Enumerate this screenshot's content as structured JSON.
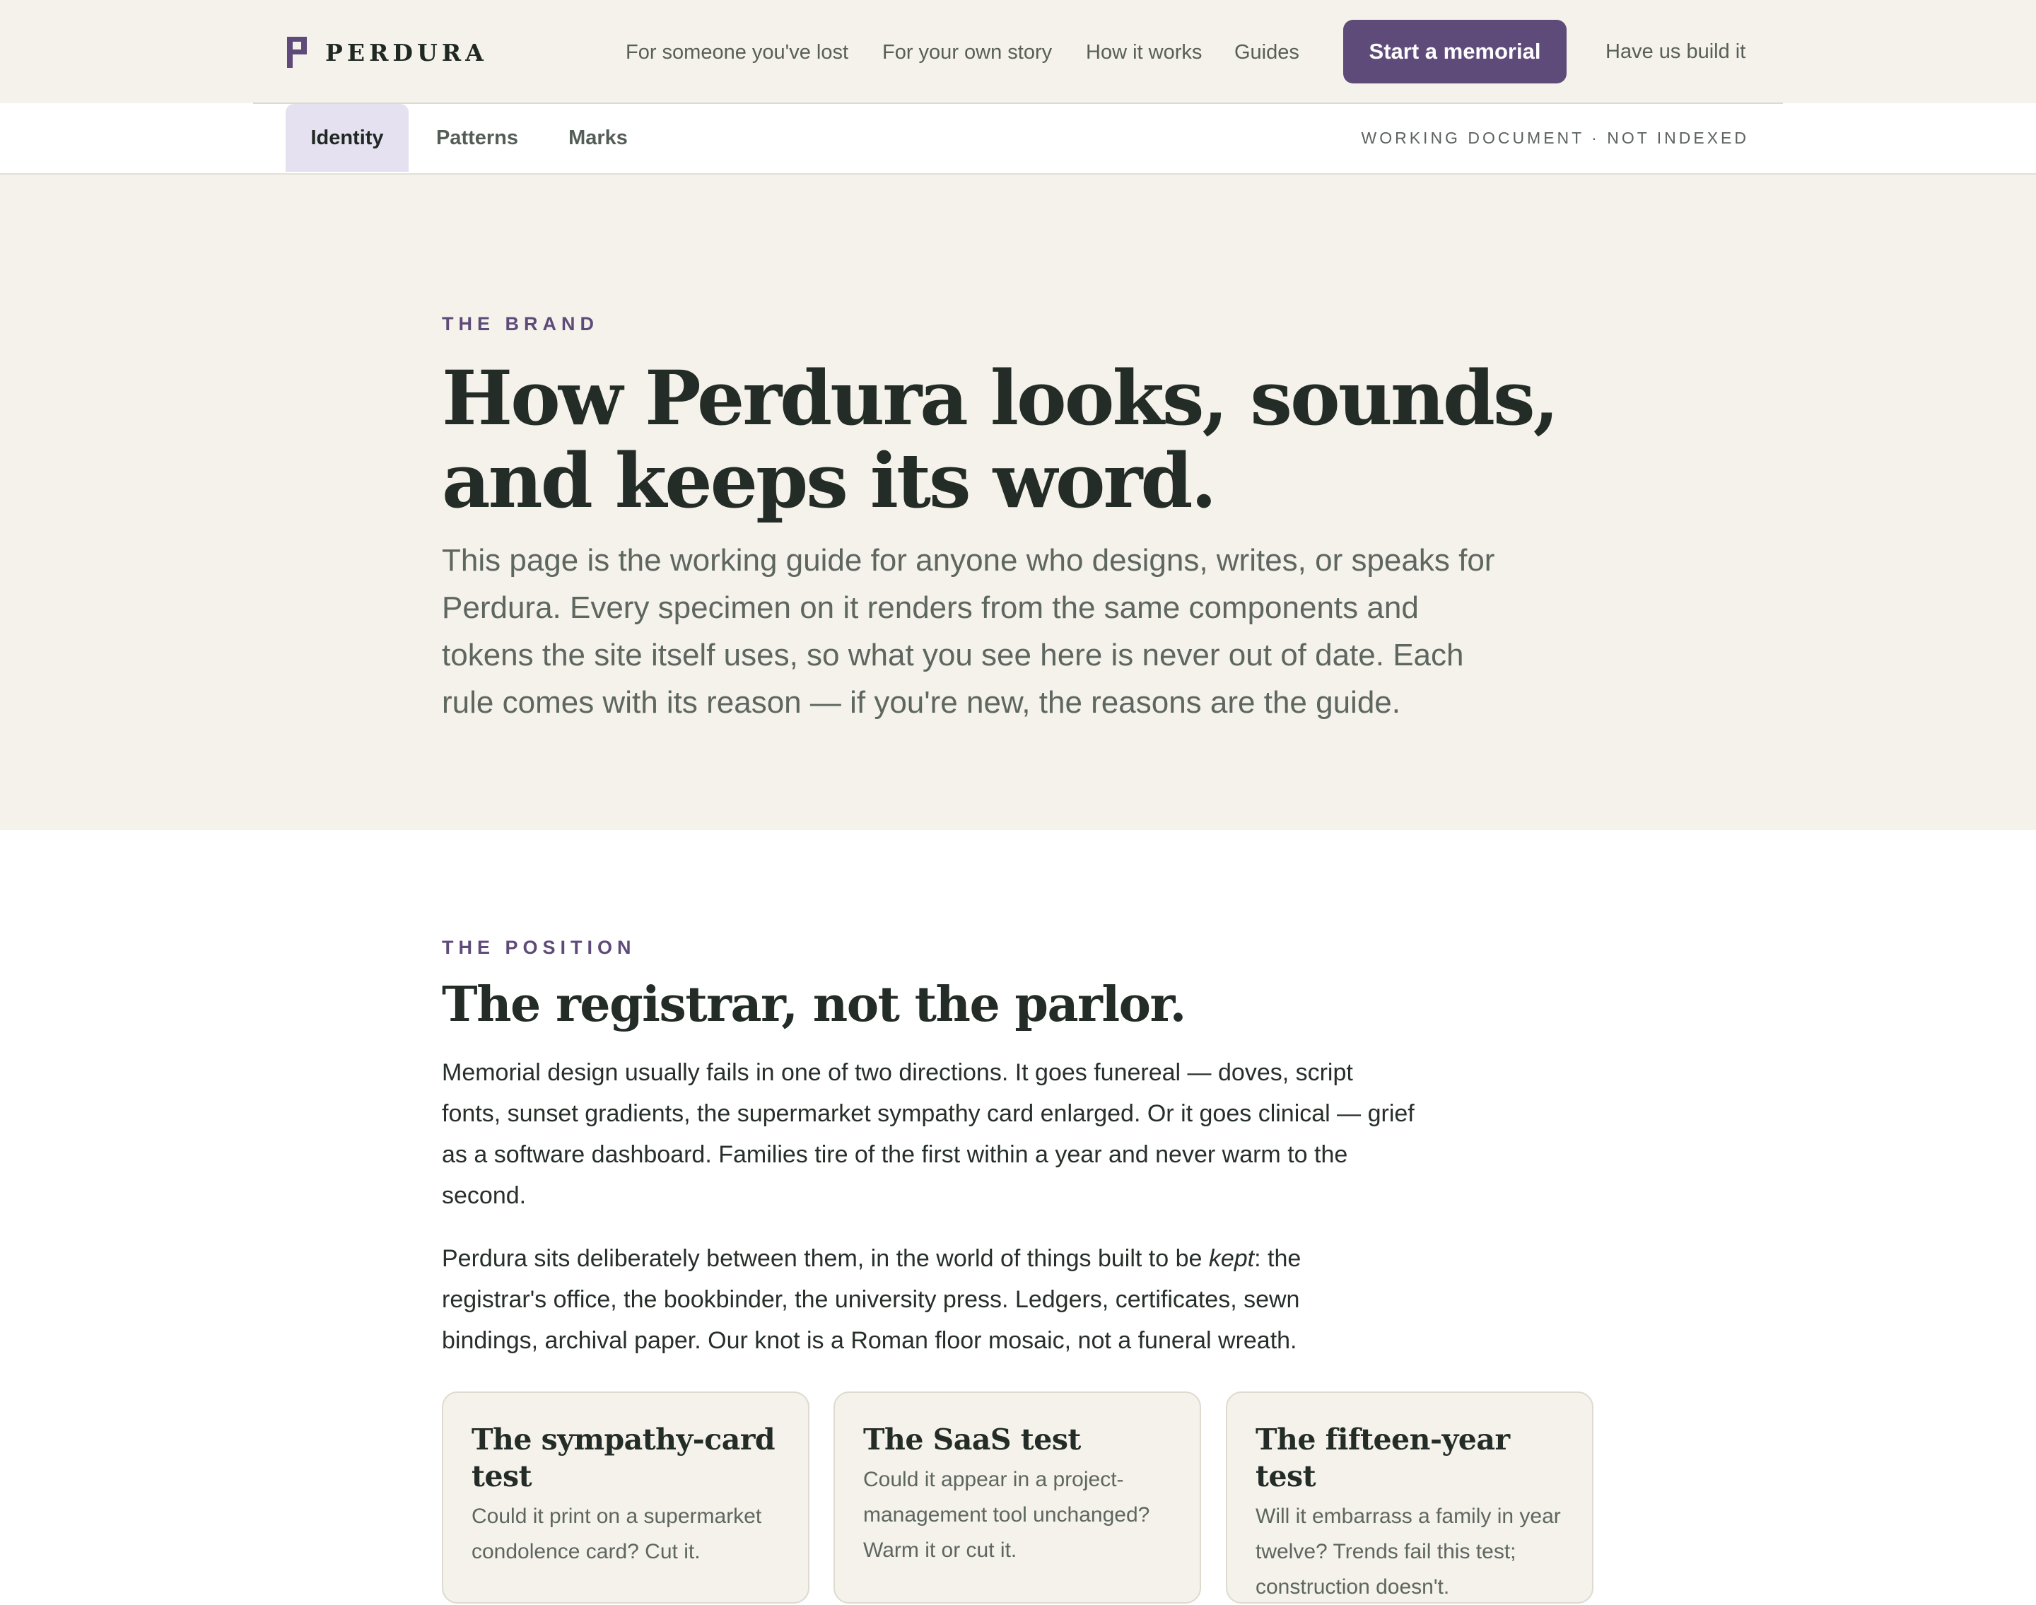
{
  "header": {
    "brand": "PERDURA",
    "nav": [
      "For someone you've lost",
      "For your own story",
      "How it works",
      "Guides"
    ],
    "cta_label": "Start a memorial",
    "secondary_link": "Have us build it",
    "accent_color": "#5e4b7a",
    "background_color": "#f4f2ea"
  },
  "subnav": {
    "tabs": [
      "Identity",
      "Patterns",
      "Marks"
    ],
    "active_tab": "Identity",
    "status": "WORKING DOCUMENT · NOT INDEXED"
  },
  "hero": {
    "eyebrow": "THE BRAND",
    "title": "How Perdura looks, sounds, and keeps its word.",
    "lede": "This page is the working guide for anyone who designs, writes, or speaks for Perdura. Every specimen on it renders from the same components and tokens the site itself uses, so what you see here is never out of date. Each rule comes with its reason — if you're new, the reasons are the guide."
  },
  "position": {
    "eyebrow": "THE POSITION",
    "title": "The registrar, not the parlor.",
    "para1": "Memorial design usually fails in one of two directions. It goes funereal — doves, script fonts, sunset gradients, the supermarket sympathy card enlarged. Or it goes clinical — grief as a software dashboard. Families tire of the first within a year and never warm to the second.",
    "para2_before": "Perdura sits deliberately between them, in the world of things built to be ",
    "para2_emphasis": "kept",
    "para2_after": ": the registrar's office, the bookbinder, the university press. Ledgers, certificates, sewn bindings, archival paper. Our knot is a Roman floor mosaic, not a funeral wreath.",
    "cards": [
      {
        "title": "The sympathy-card test",
        "body": "Could it print on a supermarket condolence card? Cut it."
      },
      {
        "title": "The SaaS test",
        "body": "Could it appear in a project-management tool unchanged? Warm it or cut it."
      },
      {
        "title": "The fifteen-year test",
        "body": "Will it embarrass a family in year twelve? Trends fail this test; construction doesn't."
      }
    ]
  }
}
